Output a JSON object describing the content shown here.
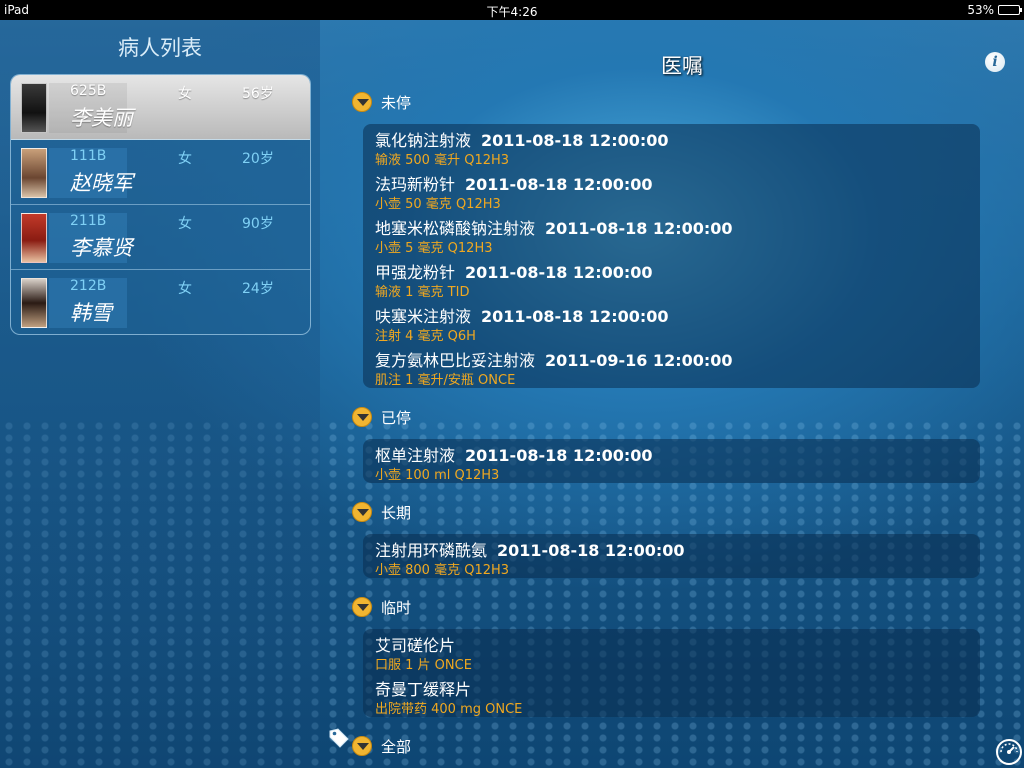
{
  "status_bar": {
    "device": "iPad",
    "time": "下午4:26",
    "battery": "53%",
    "battery_level": 0.53
  },
  "left": {
    "title": "病人列表",
    "patients": [
      {
        "bed": "625B",
        "name": "李美丽",
        "sex": "女",
        "age": "56岁",
        "selected": true
      },
      {
        "bed": "111B",
        "name": "赵晓军",
        "sex": "女",
        "age": "20岁"
      },
      {
        "bed": "211B",
        "name": "李慕贤",
        "sex": "女",
        "age": "90岁"
      },
      {
        "bed": "212B",
        "name": "韩雪",
        "sex": "女",
        "age": "24岁"
      }
    ]
  },
  "right": {
    "title": "医嘱",
    "info_icon": "info-icon",
    "sections": [
      {
        "label": "未停",
        "orders": [
          {
            "name": "氯化钠注射液",
            "date": "2011-08-18 12:00:00",
            "detail": "输液 500 毫升 Q12H3"
          },
          {
            "name": "法玛新粉针",
            "date": "2011-08-18 12:00:00",
            "detail": "小壶 50 毫克 Q12H3"
          },
          {
            "name": "地塞米松磷酸钠注射液",
            "date": "2011-08-18 12:00:00",
            "detail": "小壶 5 毫克 Q12H3"
          },
          {
            "name": "甲强龙粉针",
            "date": "2011-08-18 12:00:00",
            "detail": "输液 1 毫克 TID"
          },
          {
            "name": "呋塞米注射液",
            "date": "2011-08-18 12:00:00",
            "detail": "注射 4 毫克 Q6H"
          },
          {
            "name": "复方氨林巴比妥注射液",
            "date": "2011-09-16 12:00:00",
            "detail": "肌注 1 毫升/安瓶 ONCE"
          }
        ]
      },
      {
        "label": "已停",
        "orders": [
          {
            "name": "枢单注射液",
            "date": "2011-08-18 12:00:00",
            "detail": "小壶 100 ml Q12H3"
          }
        ]
      },
      {
        "label": "长期",
        "orders": [
          {
            "name": "注射用环磷酰氨",
            "date": "2011-08-18 12:00:00",
            "detail": "小壶 800 毫克 Q12H3"
          }
        ]
      },
      {
        "label": "临时",
        "orders": [
          {
            "name": "艾司磋伦片",
            "date": "",
            "detail": "口服 1 片 ONCE"
          },
          {
            "name": "奇曼丁缓释片",
            "date": "",
            "detail": "出院带药 400 mg ONCE"
          }
        ]
      },
      {
        "label": "全部",
        "orders": []
      }
    ]
  },
  "icons": {
    "section_toggle": "chevron-down-icon",
    "tag": "tag-icon",
    "gauge": "gauge-icon"
  },
  "colors": {
    "accent_orange": "#f1b531",
    "detail_text": "#f0a820",
    "bed_text": "#7fd0f5"
  }
}
